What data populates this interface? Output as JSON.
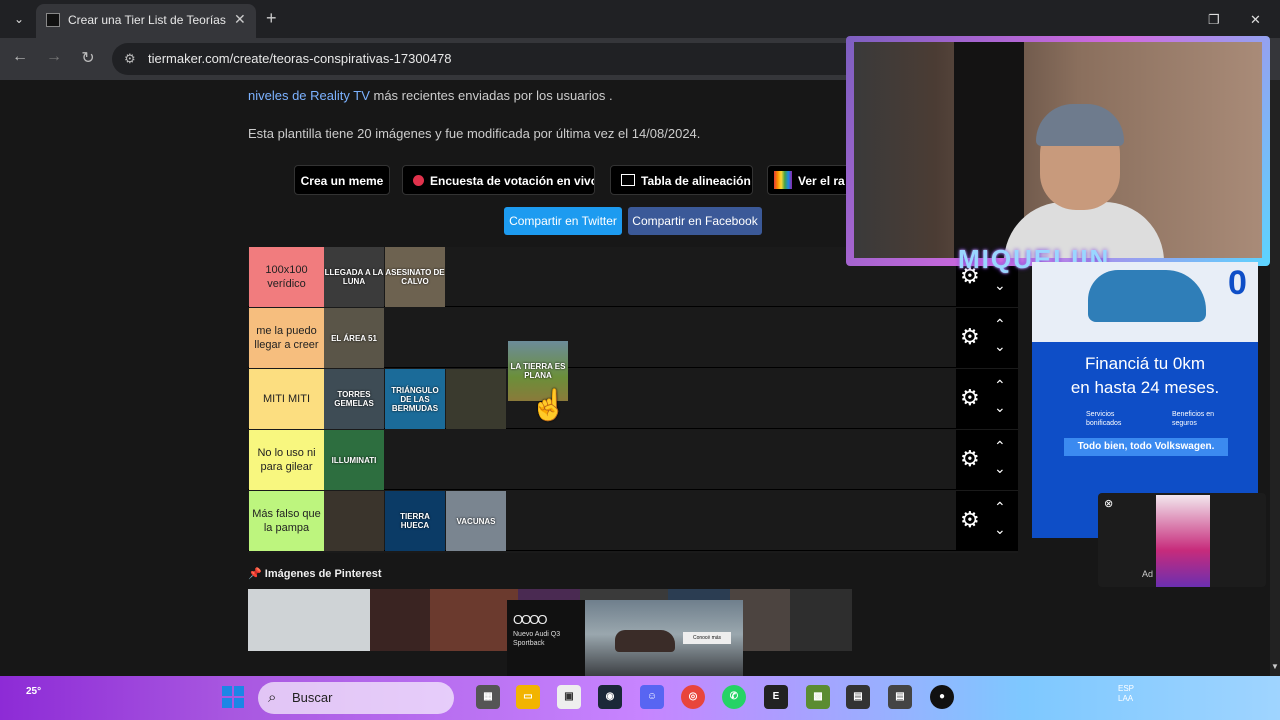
{
  "browser": {
    "tab_title": "Crear una Tier List de Teorías C",
    "url": "tiermaker.com/create/teoras-conspirativas-17300478"
  },
  "page": {
    "desc_link": "niveles de Reality TV",
    "desc_rest": " más recientes enviadas por los usuarios .",
    "template_info": "Esta plantilla tiene 20 imágenes y fue modificada por última vez el 14/08/2024.",
    "buttons": {
      "meme": "Crea un meme",
      "poll": "Encuesta de votación en vivo",
      "alignment": "Tabla de alineación",
      "ranking": "Ver el ra"
    },
    "share": {
      "twitter": "Compartir en Twitter",
      "facebook": "Compartir en Facebook"
    },
    "pinterest_heading": "Imágenes de Pinterest"
  },
  "tiers": [
    {
      "label": "100x100 verídico",
      "color": "#f17c7e",
      "items": [
        "LLEGADA A LA LUNA",
        "ASESINATO DE CALVO"
      ]
    },
    {
      "label": "me la puedo llegar a creer",
      "color": "#f6be7e",
      "items": [
        "EL ÁREA 51"
      ]
    },
    {
      "label": "MITI MITI",
      "color": "#fcde80",
      "items": [
        "TORRES GEMELAS",
        "TRIÁNGULO DE LAS BERMUDAS",
        ""
      ]
    },
    {
      "label": "No lo uso ni para gilear",
      "color": "#f8f77f",
      "items": [
        "ILLUMINATI"
      ]
    },
    {
      "label": "Más falso que la pampa",
      "color": "#bdf57e",
      "items": [
        "",
        "TIERRA HUECA",
        "VACUNAS"
      ]
    }
  ],
  "dragging_item": "LA TIERRA ES PLANA",
  "audi_ad": {
    "logo": "OOOO",
    "text": "Nuevo Audi Q3 Sportback",
    "cta": "Conocé más"
  },
  "streamer_name": "MIQUELIIN",
  "vw_ad": {
    "zero": "0",
    "line1": "Financiá tu 0km",
    "line2": "en hasta 24 meses.",
    "benefit1": "Servicios bonificados",
    "benefit2": "Beneficios en seguros",
    "cta": "Todo bien, todo Volkswagen."
  },
  "mini_ad_label": "Ad",
  "taskbar": {
    "weather": "25°",
    "search_placeholder": "Buscar",
    "lang": "ESP",
    "lang2": "LAA"
  }
}
